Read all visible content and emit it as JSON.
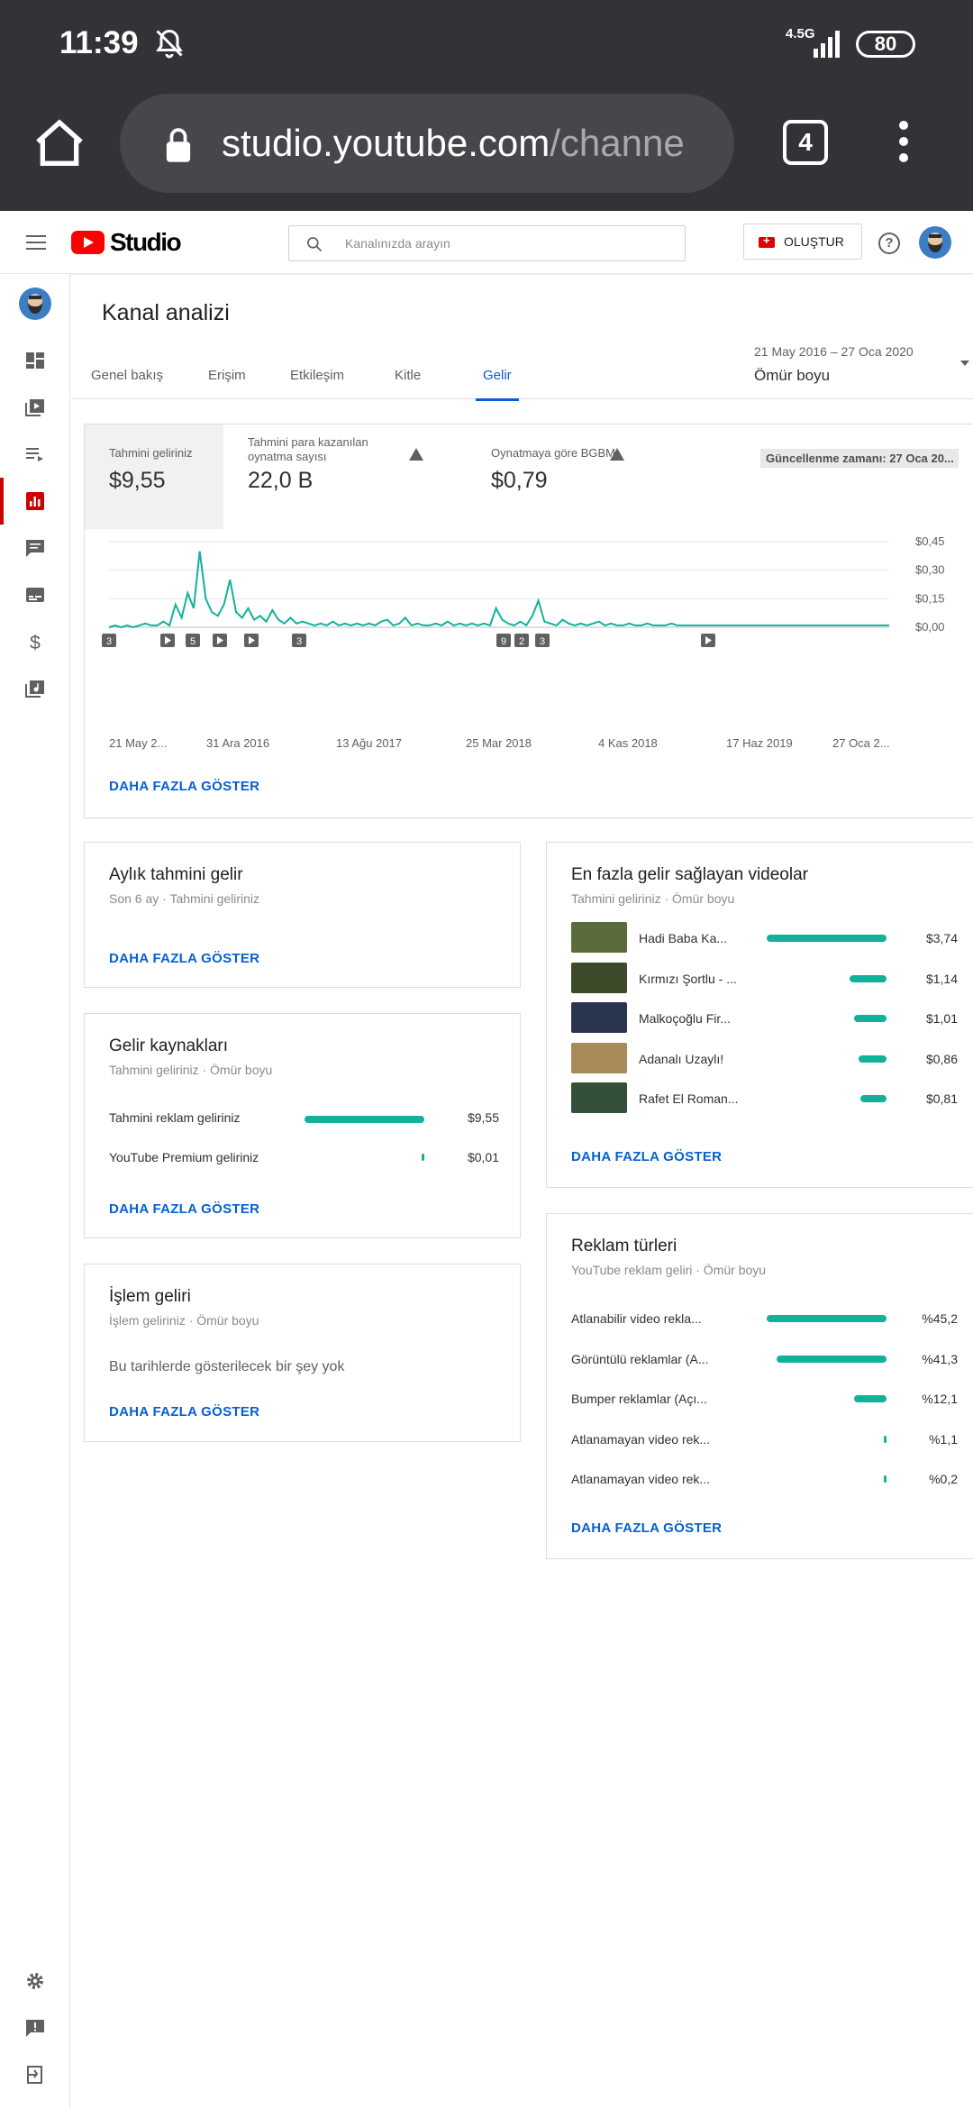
{
  "status": {
    "time": "11:39",
    "network": "4.5G",
    "battery": "80"
  },
  "browser": {
    "url_host": "studio.youtube.com",
    "url_path": "/channe",
    "tab_count": "4"
  },
  "header": {
    "logo_text": "Studio",
    "search_placeholder": "Kanalınızda arayın",
    "create_label": "OLUŞTUR",
    "help_label": "?"
  },
  "page": {
    "title": "Kanal analizi",
    "tabs": [
      {
        "label": "Genel bakış"
      },
      {
        "label": "Erişim"
      },
      {
        "label": "Etkileşim"
      },
      {
        "label": "Kitle"
      },
      {
        "label": "Gelir",
        "active": true
      }
    ],
    "date_range": "21 May 2016 – 27 Oca 2020",
    "date_label": "Ömür boyu"
  },
  "overview": {
    "metrics": [
      {
        "label": "Tahmini geliriniz",
        "value": "$9,55"
      },
      {
        "label": "Tahmini para kazanılan oynatma sayısı",
        "value": "22,0 B"
      },
      {
        "label": "Oynatmaya göre BGBM",
        "value": "$0,79"
      }
    ],
    "updated": "Güncellenme zamanı: 27 Oca 20...",
    "more": "DAHA FAZLA GÖSTER"
  },
  "chart_data": {
    "type": "line",
    "x_ticks": [
      "21 May 2...",
      "31 Ara 2016",
      "13 Ağu 2017",
      "25 Mar 2018",
      "4 Kas 2018",
      "17 Haz 2019",
      "27 Oca 2..."
    ],
    "y_ticks": [
      "$0,45",
      "$0,30",
      "$0,15",
      "$0,00"
    ],
    "ylim": [
      0,
      0.45
    ],
    "series": [
      {
        "values": [
          0,
          0.01,
          0,
          0.01,
          0,
          0.01,
          0.02,
          0.01,
          0.01,
          0.03,
          0.01,
          0.12,
          0.05,
          0.18,
          0.1,
          0.4,
          0.15,
          0.08,
          0.06,
          0.12,
          0.25,
          0.08,
          0.05,
          0.1,
          0.04,
          0.06,
          0.03,
          0.09,
          0.04,
          0.02,
          0.05,
          0.02,
          0.03,
          0.02,
          0.01,
          0.02,
          0.01,
          0.03,
          0.01,
          0.02,
          0.01,
          0.02,
          0.01,
          0.02,
          0.01,
          0.03,
          0.04,
          0.01,
          0.02,
          0.05,
          0.01,
          0.02,
          0.01,
          0.01,
          0.02,
          0.01,
          0.03,
          0.01,
          0.02,
          0.01,
          0.02,
          0.01,
          0.02,
          0.01,
          0.1,
          0.04,
          0.02,
          0.01,
          0.03,
          0.01,
          0.06,
          0.14,
          0.03,
          0.02,
          0.01,
          0.04,
          0.02,
          0.01,
          0.02,
          0.01,
          0.02,
          0.03,
          0.01,
          0.02,
          0.01,
          0.01,
          0.02,
          0.01,
          0.01,
          0.02,
          0.01,
          0.01,
          0.01,
          0.02,
          0.01,
          0.01,
          0.01,
          0.01,
          0.01,
          0.01,
          0.01,
          0.01,
          0.01,
          0.01,
          0.01,
          0.01,
          0.01,
          0.01,
          0.01,
          0.01,
          0.01,
          0.01,
          0.01,
          0.01,
          0.01,
          0.01,
          0.01,
          0.01,
          0.01,
          0.01,
          0.01,
          0.01,
          0.01,
          0.01,
          0.01,
          0.01,
          0.01,
          0.01,
          0.01,
          0.01
        ]
      }
    ],
    "markers": [
      "3",
      "",
      "5",
      "",
      "",
      "3",
      "9",
      "2",
      "3",
      ""
    ]
  },
  "monthly": {
    "title": "Aylık tahmini gelir",
    "subtitle": "Son 6 ay · Tahmini geliriniz",
    "more": "DAHA FAZLA GÖSTER"
  },
  "sources": {
    "title": "Gelir kaynakları",
    "subtitle": "Tahmini geliriniz · Ömür boyu",
    "rows": [
      {
        "label": "Tahmini reklam geliriniz",
        "value": "$9,55",
        "share": 0.999
      },
      {
        "label": "YouTube Premium geliriniz",
        "value": "$0,01",
        "share": 0.001
      }
    ],
    "more": "DAHA FAZLA GÖSTER"
  },
  "transactions": {
    "title": "İşlem geliri",
    "subtitle": "İşlem geliriniz · Ömür boyu",
    "empty": "Bu tarihlerde gösterilecek bir şey yok",
    "more": "DAHA FAZLA GÖSTER"
  },
  "top_videos": {
    "title": "En fazla gelir sağlayan videolar",
    "subtitle": "Tahmini geliriniz · Ömür boyu",
    "rows": [
      {
        "label": "Hadi Baba Ka...",
        "value": "$3,74",
        "amount": 3.74,
        "thumb": "#5a6b3c"
      },
      {
        "label": "Kırmızı Şortlu - ...",
        "value": "$1,14",
        "amount": 1.14,
        "thumb": "#3d4a2a"
      },
      {
        "label": "Malkoçoğlu Fir...",
        "value": "$1,01",
        "amount": 1.01,
        "thumb": "#2a3550"
      },
      {
        "label": "Adanalı Uzaylı!",
        "value": "$0,86",
        "amount": 0.86,
        "thumb": "#a88a5a"
      },
      {
        "label": "Rafet El Roman...",
        "value": "$0,81",
        "amount": 0.81,
        "thumb": "#34503a"
      }
    ],
    "more": "DAHA FAZLA GÖSTER"
  },
  "ad_types": {
    "title": "Reklam türleri",
    "subtitle": "YouTube reklam geliri · Ömür boyu",
    "rows": [
      {
        "label": "Atlanabilir video rekla...",
        "value": "%45,2",
        "pct": 45.2
      },
      {
        "label": "Görüntülü reklamlar (A...",
        "value": "%41,3",
        "pct": 41.3
      },
      {
        "label": "Bumper reklamlar (Açı...",
        "value": "%12,1",
        "pct": 12.1
      },
      {
        "label": "Atlanamayan video rek...",
        "value": "%1,1",
        "pct": 1.1
      },
      {
        "label": "Atlanamayan video rek...",
        "value": "%0,2",
        "pct": 0.2
      }
    ],
    "more": "DAHA FAZLA GÖSTER"
  },
  "colors": {
    "accent": "#12b19a",
    "link": "#065fd4",
    "brand": "#ff0000",
    "active": "#cc0000"
  }
}
